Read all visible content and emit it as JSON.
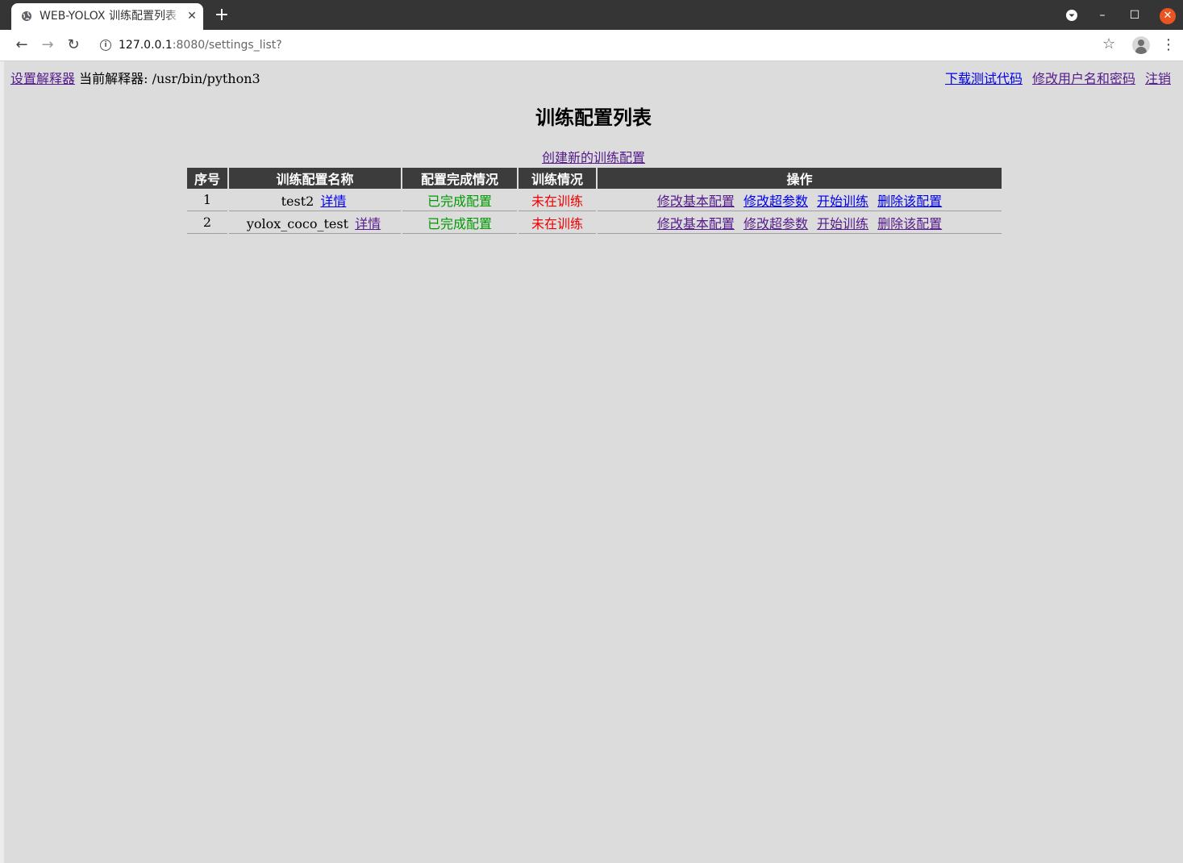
{
  "browser": {
    "tab_title": "WEB-YOLOX 训练配置列表",
    "url_host": "127.0.0.1",
    "url_rest": ":8080/settings_list?"
  },
  "header": {
    "set_interpreter": "设置解释器",
    "current_interpreter_label": "当前解释器: /usr/bin/python3",
    "download_test_code": "下载测试代码",
    "change_credentials": "修改用户名和密码",
    "logout": "注销"
  },
  "page_title": "训练配置列表",
  "create_link": "创建新的训练配置",
  "table": {
    "headers": [
      "序号",
      "训练配置名称",
      "配置完成情况",
      "训练情况",
      "操作"
    ],
    "rows": [
      {
        "index": "1",
        "name": "test2",
        "detail": "详情",
        "config_status": "已完成配置",
        "train_status": "未在训练",
        "actions": [
          "修改基本配置",
          "修改超参数",
          "开始训练",
          "删除该配置"
        ]
      },
      {
        "index": "2",
        "name": "yolox_coco_test",
        "detail": "详情",
        "config_status": "已完成配置",
        "train_status": "未在训练",
        "actions": [
          "修改基本配置",
          "修改超参数",
          "开始训练",
          "删除该配置"
        ]
      }
    ]
  },
  "colors": {
    "status_ok": "#009900",
    "status_bad": "#ee0000",
    "visited_link": "#551a8b",
    "link": "#0000ee"
  }
}
